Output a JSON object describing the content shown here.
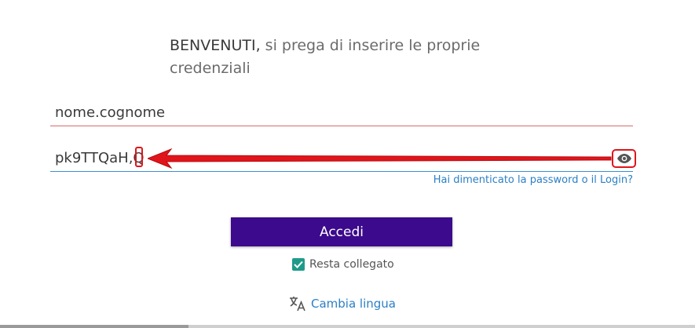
{
  "header": {
    "welcome_strong": "BENVENUTI,",
    "welcome_rest": " si prega di inserire le proprie credenziali"
  },
  "form": {
    "username_value": "nome.cognome",
    "password_value": "pk9TTQaH,Q",
    "forgot_link": "Hai dimenticato la password o il Login?",
    "submit_label": "Accedi",
    "remember_label": "Resta collegato",
    "remember_checked": true
  },
  "footer": {
    "language_label": "Cambia lingua"
  },
  "colors": {
    "submit_bg": "#3c0a8c",
    "link": "#2b7fc6",
    "checkbox": "#1f9a8a",
    "annotation_red": "#e0151b"
  },
  "icons": {
    "eye": "eye-icon",
    "translate": "translate-icon",
    "check": "check-icon",
    "arrow": "arrow-annotation"
  }
}
